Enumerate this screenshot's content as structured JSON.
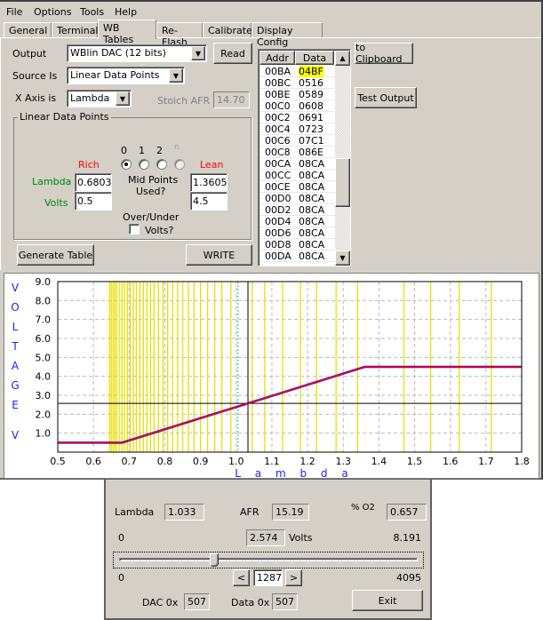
{
  "menu": [
    "File",
    "Options",
    "Tools",
    "Help"
  ],
  "tabs": [
    "General",
    "Terminal",
    "WB Tables",
    "Re-Flash",
    "Calibrate",
    "Display Config"
  ],
  "active_tab": "WB Tables",
  "output": {
    "label": "Output",
    "value": "WBlin DAC (12 bits)",
    "read": "Read"
  },
  "source": {
    "label": "Source Is",
    "value": "Linear Data Points"
  },
  "xaxis": {
    "label": "X Axis is",
    "value": "Lambda",
    "stoich_label": "Stoich AFR",
    "stoich_value": "14.70"
  },
  "ldp": {
    "title": "Linear Data Points",
    "rich": "Rich",
    "lean": "Lean",
    "lambda": "Lambda",
    "volts": "Volts",
    "rich_lambda": "0.6803",
    "rich_volts": "0.5",
    "lean_lambda": "1.3605",
    "lean_volts": "4.5",
    "mid_options": [
      "0",
      "1",
      "2",
      "n"
    ],
    "mid_selected": "0",
    "mid_label1": "Mid Points",
    "mid_label2": "Used?",
    "over_label": "Over/Under",
    "over_check": "Volts?",
    "over_checked": false
  },
  "buttons": {
    "generate": "Generate Table",
    "write": "WRITE",
    "clipboard": "to Clipboard",
    "test": "Test Output"
  },
  "table": {
    "headers": [
      "Addr",
      "Data"
    ],
    "highlight_color": "#ffff00",
    "rows": [
      [
        "00BA",
        "04BF"
      ],
      [
        "00BC",
        "0516"
      ],
      [
        "00BE",
        "0589"
      ],
      [
        "00C0",
        "0608"
      ],
      [
        "00C2",
        "0691"
      ],
      [
        "00C4",
        "0723"
      ],
      [
        "00C6",
        "07C1"
      ],
      [
        "00C8",
        "086E"
      ],
      [
        "00CA",
        "08CA"
      ],
      [
        "00CC",
        "08CA"
      ],
      [
        "00CE",
        "08CA"
      ],
      [
        "00D0",
        "08CA"
      ],
      [
        "00D2",
        "08CA"
      ],
      [
        "00D4",
        "08CA"
      ],
      [
        "00D6",
        "08CA"
      ],
      [
        "00D8",
        "08CA"
      ],
      [
        "00DA",
        "08CA"
      ]
    ]
  },
  "chart_data": {
    "type": "line",
    "xlabel": "L a m b d a",
    "ylabel": "V O L T A G E   V",
    "xlim": [
      0.5,
      1.8
    ],
    "ylim": [
      0,
      9
    ],
    "xticks": [
      "0.5",
      "0.6",
      "0.7",
      "0.8",
      "0.9",
      "1.0",
      "1.1",
      "1.2",
      "1.3",
      "1.4",
      "1.5",
      "1.6",
      "1.7",
      "1.8"
    ],
    "yticks": [
      "1.0",
      "2.0",
      "3.0",
      "4.0",
      "5.0",
      "6.0",
      "7.0",
      "8.0",
      "9.0"
    ],
    "grid": true,
    "series": [
      {
        "color": "#ff0000",
        "x": [
          0.5,
          0.6803,
          1.3605,
          1.8
        ],
        "y": [
          0.5,
          0.5,
          4.5,
          4.5
        ]
      }
    ],
    "table_points_lambda": [
      0.645,
      0.65,
      0.655,
      0.66,
      0.665,
      0.672,
      0.68,
      0.687,
      0.695,
      0.703,
      0.712,
      0.72,
      0.73,
      0.74,
      0.75,
      0.76,
      0.77,
      0.782,
      0.795,
      0.808,
      0.822,
      0.836,
      0.85,
      0.866,
      0.882,
      0.9,
      0.92,
      0.94,
      0.96,
      0.985,
      1.045,
      1.08,
      1.13,
      1.18,
      1.225,
      1.28,
      1.34,
      1.47,
      1.545,
      1.625,
      1.715
    ],
    "stoich_marker": 1.005,
    "cursor": {
      "x": 1.033,
      "y": 2.574
    }
  },
  "test": {
    "lambda_label": "Lambda",
    "lambda": "1.033",
    "afr_label": "AFR",
    "afr": "15.19",
    "o2_label": "% O2",
    "o2_value": "0.657",
    "vmin": "0",
    "volts": "2.574",
    "volts_label": "Volts",
    "vmax": "8.191",
    "smin": "0",
    "slider": "1287",
    "smax": "4095",
    "slider_fraction": 0.3143,
    "prev": "<",
    "next": ">",
    "dac_label": "DAC 0x",
    "dac": "507",
    "data_label": "Data 0x",
    "data": "507",
    "exit": "Exit"
  }
}
